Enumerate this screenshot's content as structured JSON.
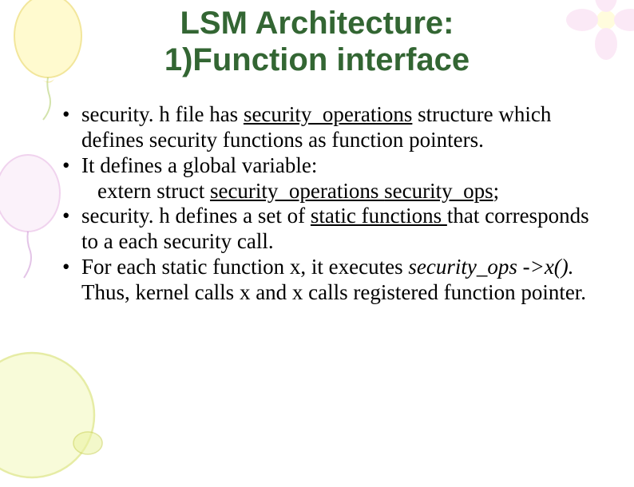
{
  "title_line1": "LSM Architecture:",
  "title_line2": "1)Function interface",
  "bullets": {
    "b1_a": "security. h file has ",
    "b1_u": "security_operations",
    "b1_b": " structure which defines security functions as function pointers.",
    "b2_a": "It defines a global variable:",
    "b2_indent_a": "extern struct ",
    "b2_indent_u1": "security_operations ",
    "b2_indent_u2": "security_ops",
    "b2_indent_b": ";",
    "b3_a": "security. h defines a set of ",
    "b3_u": "static functions ",
    "b3_b": "that corresponds to a each security call.",
    "b4_a": "For each static function x, it executes  ",
    "b4_i": "security_ops ->x().",
    "b4_b": " Thus, kernel calls x and x calls registered function pointer."
  }
}
